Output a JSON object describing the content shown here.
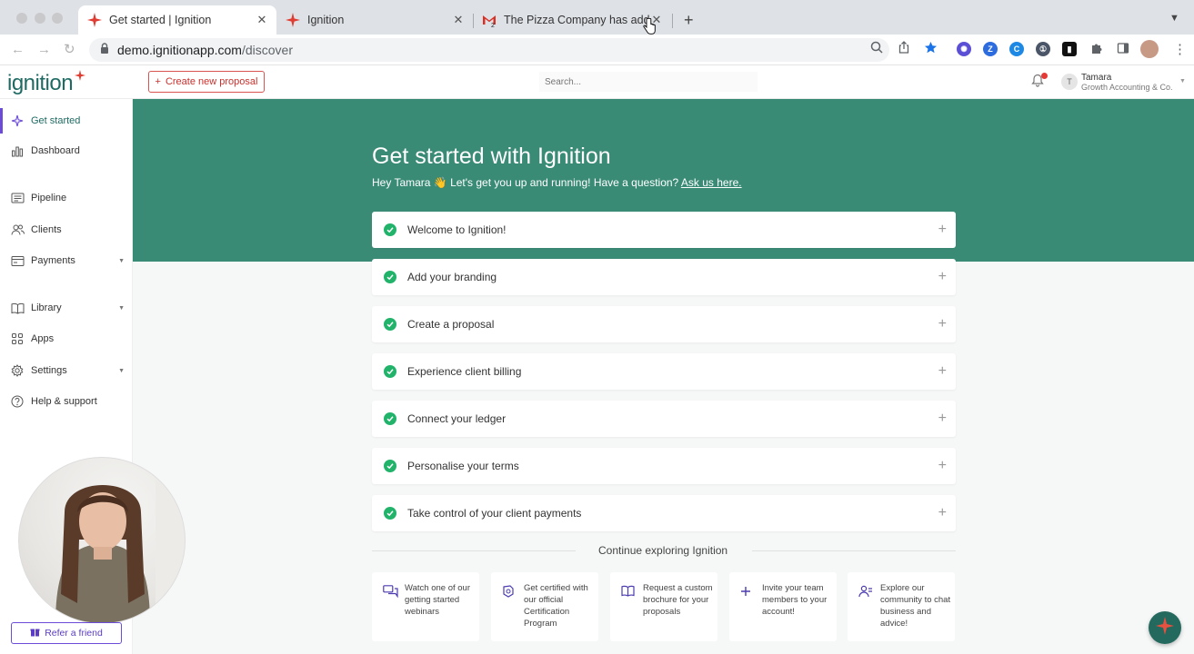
{
  "browser": {
    "tabs": [
      {
        "title": "Get started | Ignition",
        "active": true
      },
      {
        "title": "Ignition",
        "active": false
      },
      {
        "title": "The Pizza Company has adde",
        "active": false
      }
    ],
    "gmail_badge": "2",
    "url_host": "demo.ignitionapp.com",
    "url_path": "/discover"
  },
  "header": {
    "logo": "ignition",
    "create_label": "Create new proposal",
    "search_placeholder": "Search...",
    "user_initial": "T",
    "user_name": "Tamara",
    "user_org": "Growth Accounting & Co."
  },
  "sidebar": {
    "items": [
      {
        "label": "Get started"
      },
      {
        "label": "Dashboard"
      },
      {
        "label": "Pipeline"
      },
      {
        "label": "Clients"
      },
      {
        "label": "Payments"
      },
      {
        "label": "Library"
      },
      {
        "label": "Apps"
      },
      {
        "label": "Settings"
      },
      {
        "label": "Help & support"
      }
    ],
    "refer_label": "Refer a friend"
  },
  "hero": {
    "title": "Get started with Ignition",
    "subtitle": "Hey Tamara 👋 Let's get you up and running! Have a question?",
    "link": "Ask us here."
  },
  "steps": [
    {
      "label": "Welcome to Ignition!",
      "done": true
    },
    {
      "label": "Add your branding",
      "done": true
    },
    {
      "label": "Create a proposal",
      "done": true
    },
    {
      "label": "Experience client billing",
      "done": true
    },
    {
      "label": "Connect your ledger",
      "done": true
    },
    {
      "label": "Personalise your terms",
      "done": true
    },
    {
      "label": "Take control of your client payments",
      "done": true
    }
  ],
  "continue": {
    "label": "Continue exploring Ignition",
    "cards": [
      {
        "text": "Watch one of our getting started webinars"
      },
      {
        "text": "Get certified with our official Certification Program"
      },
      {
        "text": "Request a custom brochure for your proposals"
      },
      {
        "text": "Invite your team members to your account!"
      },
      {
        "text": "Explore our community to chat business and advice!"
      }
    ]
  },
  "colors": {
    "brand_green": "#3a8b76",
    "accent_purple": "#6c4bd8",
    "brand_red": "#e03c31",
    "check_green": "#21b36a"
  }
}
